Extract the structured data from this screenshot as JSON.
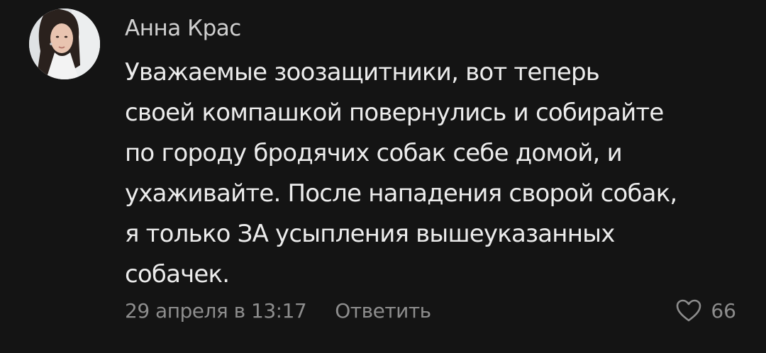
{
  "comment": {
    "author": "Анна Крас",
    "text_lines": [
      "Уважаемые зоозащитники, вот теперь",
      "своей компашкой повернулись и собирайте",
      "по городу бродячих собак себе домой, и",
      "ухаживайте. После нападения сворой собак,",
      "я только ЗА усыпления вышеуказанных",
      "собачек."
    ],
    "timestamp": "29 апреля в 13:17",
    "reply_label": "Ответить",
    "likes_count": "66",
    "like_icon": "heart-outline-icon"
  },
  "colors": {
    "background": "#141414",
    "text": "#ececec",
    "muted": "#8d8d8d"
  }
}
